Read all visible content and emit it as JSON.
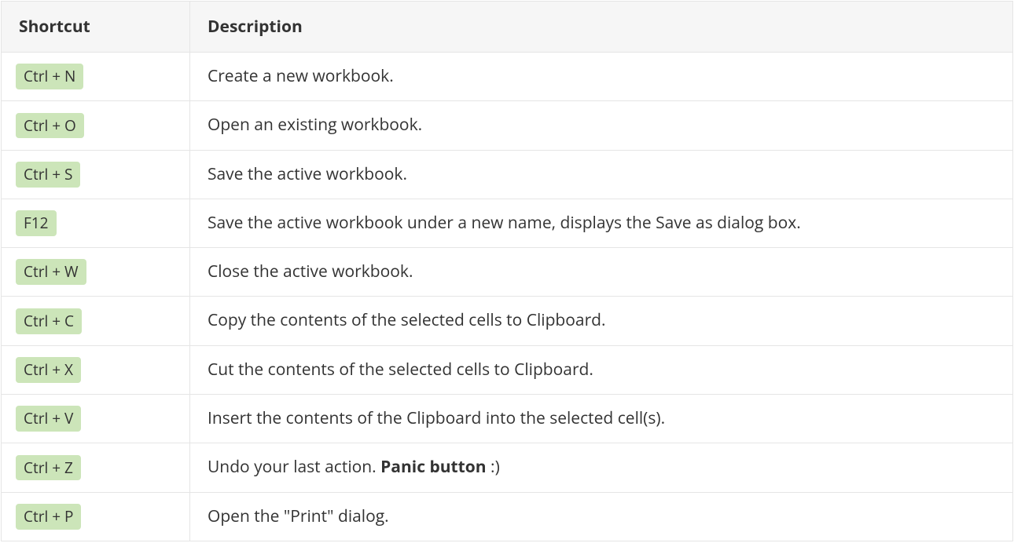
{
  "headers": {
    "shortcut": "Shortcut",
    "description": "Description"
  },
  "rows": [
    {
      "shortcut": "Ctrl + N",
      "description_parts": [
        {
          "text": "Create a new workbook.",
          "bold": false
        }
      ]
    },
    {
      "shortcut": "Ctrl + O",
      "description_parts": [
        {
          "text": "Open an existing workbook.",
          "bold": false
        }
      ]
    },
    {
      "shortcut": "Ctrl + S",
      "description_parts": [
        {
          "text": "Save the active workbook.",
          "bold": false
        }
      ]
    },
    {
      "shortcut": "F12",
      "description_parts": [
        {
          "text": "Save the active workbook under a new name, displays the Save as dialog box.",
          "bold": false
        }
      ]
    },
    {
      "shortcut": "Ctrl + W",
      "description_parts": [
        {
          "text": "Close the active workbook.",
          "bold": false
        }
      ]
    },
    {
      "shortcut": "Ctrl + C",
      "description_parts": [
        {
          "text": "Copy the contents of the selected cells to Clipboard.",
          "bold": false
        }
      ]
    },
    {
      "shortcut": "Ctrl + X",
      "description_parts": [
        {
          "text": "Cut the contents of the selected cells to Clipboard.",
          "bold": false
        }
      ]
    },
    {
      "shortcut": "Ctrl + V",
      "description_parts": [
        {
          "text": "Insert the contents of the Clipboard into the selected cell(s).",
          "bold": false
        }
      ]
    },
    {
      "shortcut": "Ctrl + Z",
      "description_parts": [
        {
          "text": "Undo your last action. ",
          "bold": false
        },
        {
          "text": "Panic button",
          "bold": true
        },
        {
          "text": " :)",
          "bold": false
        }
      ]
    },
    {
      "shortcut": "Ctrl + P",
      "description_parts": [
        {
          "text": "Open the \"Print\" dialog.",
          "bold": false
        }
      ]
    }
  ]
}
